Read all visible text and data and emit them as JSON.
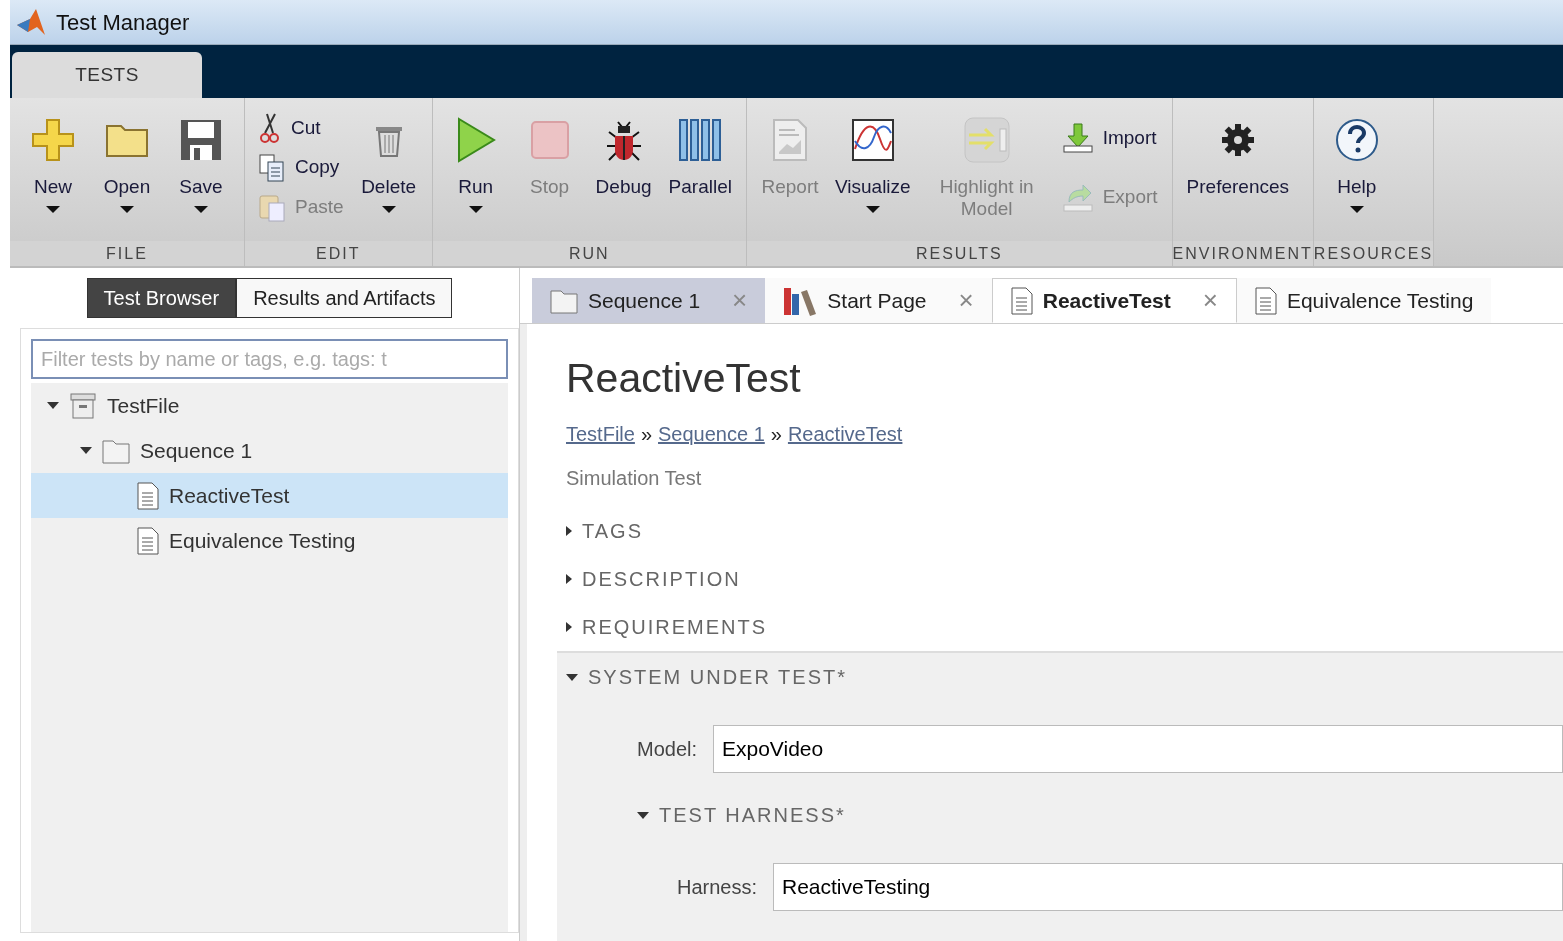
{
  "window": {
    "title": "Test Manager"
  },
  "ribbon_tabs": [
    {
      "label": "TESTS",
      "selected": true
    }
  ],
  "toolstrip": [
    {
      "label": "FILE",
      "items": [
        {
          "kind": "large",
          "label": "New",
          "dropdown": true,
          "disabled": false
        },
        {
          "kind": "large",
          "label": "Open",
          "dropdown": true,
          "disabled": false
        },
        {
          "kind": "large",
          "label": "Save",
          "dropdown": true,
          "disabled": false
        }
      ]
    },
    {
      "label": "EDIT",
      "items": [
        {
          "kind": "stack",
          "items": [
            {
              "label": "Cut",
              "disabled": false
            },
            {
              "label": "Copy",
              "disabled": false
            },
            {
              "label": "Paste",
              "disabled": true
            }
          ]
        },
        {
          "kind": "large",
          "label": "Delete",
          "dropdown": true,
          "disabled": false
        }
      ]
    },
    {
      "label": "RUN",
      "items": [
        {
          "kind": "large",
          "label": "Run",
          "dropdown": true,
          "disabled": false
        },
        {
          "kind": "large",
          "label": "Stop",
          "dropdown": false,
          "disabled": true
        },
        {
          "kind": "large",
          "label": "Debug",
          "dropdown": false,
          "disabled": false
        },
        {
          "kind": "large",
          "label": "Parallel",
          "dropdown": false,
          "disabled": false
        }
      ]
    },
    {
      "label": "RESULTS",
      "items": [
        {
          "kind": "large",
          "label": "Report",
          "dropdown": false,
          "disabled": true
        },
        {
          "kind": "large",
          "label": "Visualize",
          "dropdown": true,
          "disabled": false
        },
        {
          "kind": "large",
          "label": "Highlight in Model",
          "dropdown": false,
          "disabled": true
        },
        {
          "kind": "stack",
          "items": [
            {
              "label": "Import",
              "disabled": false
            },
            {
              "label": "Export",
              "disabled": true
            }
          ]
        }
      ]
    },
    {
      "label": "ENVIRONMENT",
      "items": [
        {
          "kind": "large",
          "label": "Preferences",
          "dropdown": false,
          "disabled": false
        }
      ]
    },
    {
      "label": "RESOURCES",
      "items": [
        {
          "kind": "large",
          "label": "Help",
          "dropdown": true,
          "disabled": false
        }
      ]
    }
  ],
  "browser": {
    "tabs": [
      {
        "label": "Test Browser",
        "selected": true
      },
      {
        "label": "Results and Artifacts",
        "selected": false
      }
    ],
    "filter": {
      "placeholder": "Filter tests by name or tags, e.g. tags: t"
    },
    "tree": [
      {
        "kind": "file",
        "label": "TestFile",
        "expanded": true,
        "selected": false,
        "children": [
          {
            "kind": "suite",
            "label": "Sequence 1",
            "expanded": true,
            "selected": false,
            "children": [
              {
                "kind": "test",
                "label": "ReactiveTest",
                "selected": true
              },
              {
                "kind": "test",
                "label": "Equivalence Testing",
                "selected": false
              }
            ]
          }
        ]
      }
    ]
  },
  "doc_tabs": [
    {
      "kind": "suite",
      "label": "Sequence 1",
      "closable": true,
      "selected": false,
      "highlighted": true
    },
    {
      "kind": "start",
      "label": "Start Page",
      "closable": true,
      "selected": false,
      "highlighted": false
    },
    {
      "kind": "test",
      "label": "ReactiveTest",
      "closable": true,
      "selected": true,
      "highlighted": false
    },
    {
      "kind": "test",
      "label": "Equivalence Testing",
      "closable": false,
      "selected": false,
      "highlighted": false
    }
  ],
  "close_glyph": "×",
  "content": {
    "title": "ReactiveTest",
    "breadcrumb": [
      "TestFile",
      "Sequence 1",
      "ReactiveTest"
    ],
    "breadcrumb_separator": "»",
    "subtitle": "Simulation Test",
    "sections": [
      {
        "label": "TAGS",
        "expanded": false
      },
      {
        "label": "DESCRIPTION",
        "expanded": false
      },
      {
        "label": "REQUIREMENTS",
        "expanded": false
      },
      {
        "label": "SYSTEM UNDER TEST*",
        "expanded": true,
        "fields": [
          {
            "label": "Model:",
            "value": "ExpoVideo"
          }
        ],
        "subsections": [
          {
            "label": "TEST HARNESS*",
            "expanded": true,
            "fields": [
              {
                "label": "Harness:",
                "value": "ReactiveTesting"
              }
            ]
          }
        ]
      }
    ]
  }
}
